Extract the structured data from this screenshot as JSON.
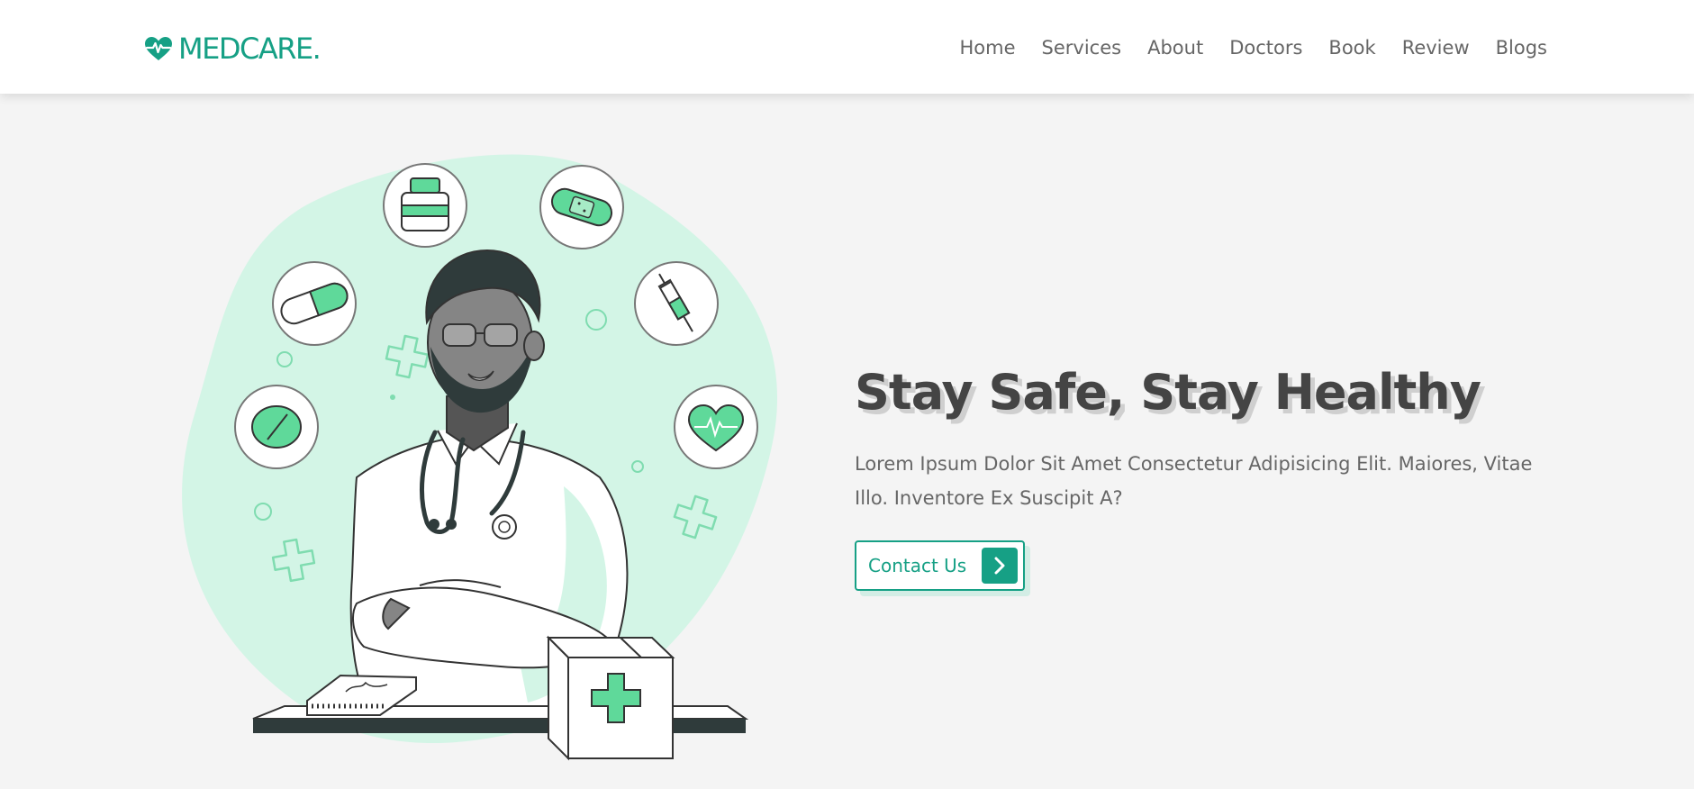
{
  "brand": {
    "name": "MEDCARE.",
    "icon": "heartbeat-icon",
    "color": "#16a085"
  },
  "nav": {
    "items": [
      {
        "label": "Home"
      },
      {
        "label": "Services"
      },
      {
        "label": "About"
      },
      {
        "label": "Doctors"
      },
      {
        "label": "Book"
      },
      {
        "label": "Review"
      },
      {
        "label": "Blogs"
      }
    ]
  },
  "hero": {
    "title": "Stay Safe, Stay Healthy",
    "description": "Lorem Ipsum Dolor Sit Amet Consectetur Adipisicing Elit. Maiores, Vitae Illo. Inventore Ex Suscipit A?",
    "cta_label": "Contact Us",
    "cta_icon": "chevron-right-icon",
    "illustration_icon": "doctor-illustration"
  },
  "colors": {
    "accent": "#16a085",
    "accent_light": "#d3f5e6",
    "accent_mid": "#5fd99a",
    "text_dark": "#444444",
    "text_body": "#666666",
    "page_bg": "#f4f4f4"
  }
}
